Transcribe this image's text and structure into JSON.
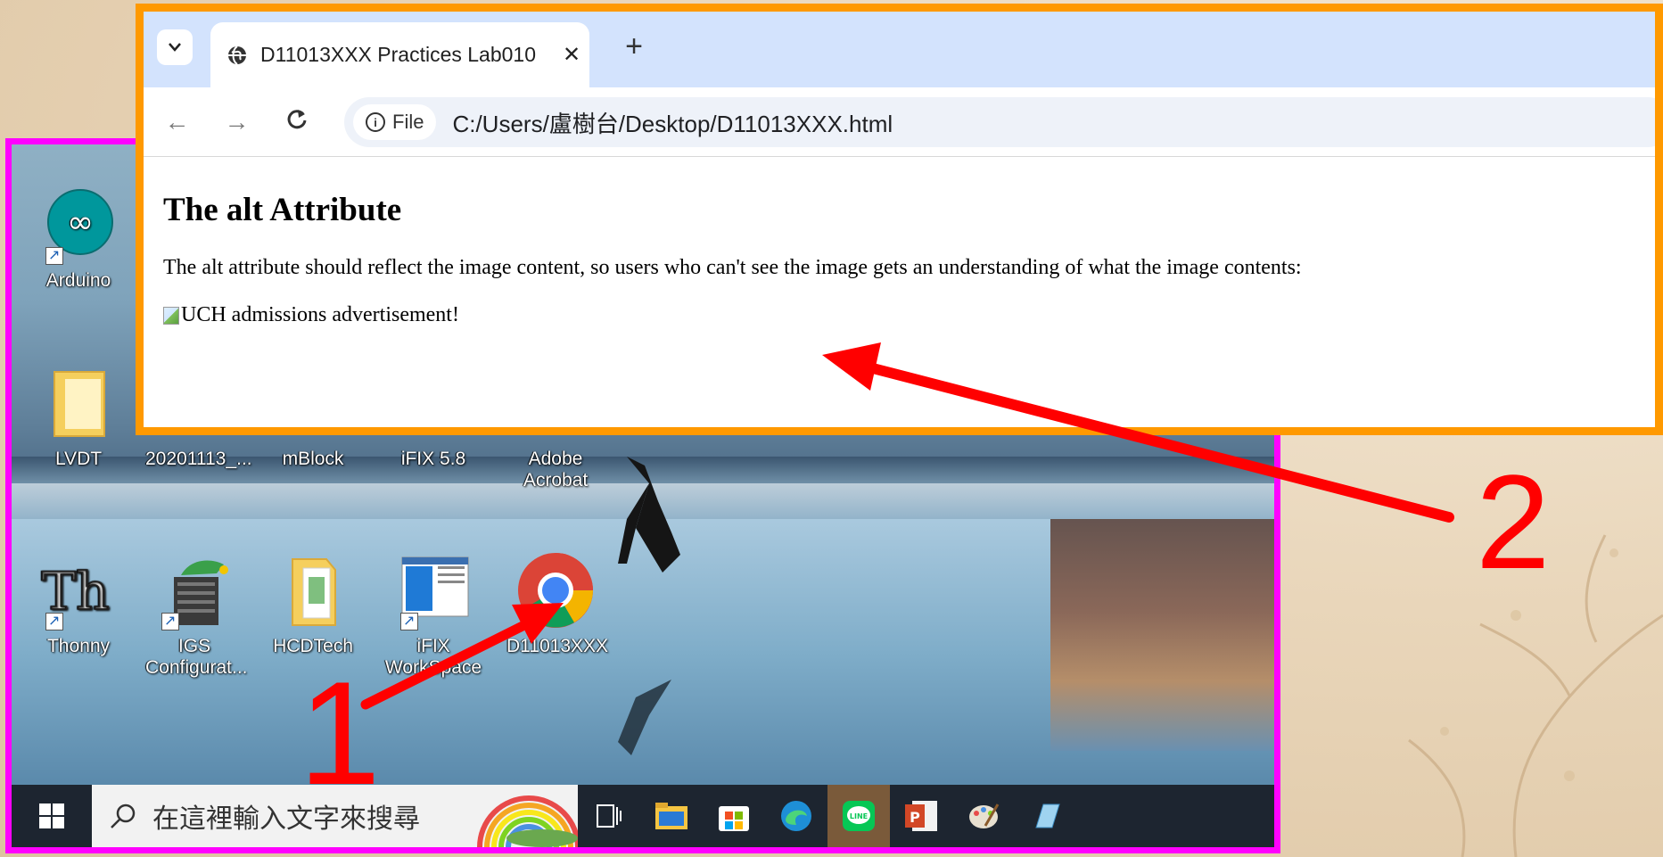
{
  "browser": {
    "tab_title": "D11013XXX Practices Lab010",
    "close_glyph": "✕",
    "new_tab_glyph": "+",
    "back_glyph": "←",
    "forward_glyph": "→",
    "reload_glyph": "C",
    "chip_label": "File",
    "url": "C:/Users/盧樹台/Desktop/D11013XXX.html",
    "page": {
      "heading": "The alt Attribute",
      "paragraph": "The alt attribute should reflect the image content, so users who can't see the image gets an understanding of what the image contents:",
      "img_alt": "UCH admissions advertisement!"
    }
  },
  "desktop": {
    "icons": [
      {
        "label": "Arduino"
      },
      {
        "label": "LVDT"
      },
      {
        "label": "20201113_..."
      },
      {
        "label": "mBlock"
      },
      {
        "label": "iFIX 5.8"
      },
      {
        "label": "Adobe Acrobat"
      },
      {
        "label": "Thonny"
      },
      {
        "label": "IGS Configurat..."
      },
      {
        "label": "HCDTech"
      },
      {
        "label": "iFIX WorkSpace"
      },
      {
        "label": "D11013XXX"
      }
    ],
    "taskbar": {
      "search_placeholder": "在這裡輸入文字來搜尋"
    }
  },
  "annotations": {
    "step1": "1",
    "step2": "2",
    "arrow_color": "#ff0000"
  },
  "colors": {
    "desktop_frame": "#ff00ff",
    "browser_frame": "#ff9900",
    "tabstrip": "#d3e3fd"
  }
}
